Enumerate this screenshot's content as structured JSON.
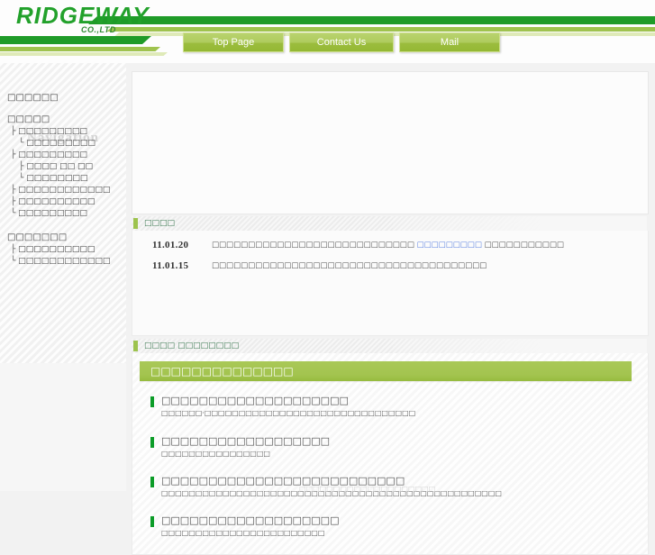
{
  "header": {
    "logo": "RIDGEWAY",
    "logo_sub": "CO.,LTD",
    "nav_buttons": [
      {
        "label": "Top Page",
        "name": "top-page"
      },
      {
        "label": "Contact Us",
        "name": "contact-us"
      },
      {
        "label": "Mail",
        "name": "mail"
      }
    ],
    "brand_green": "#1f9b28",
    "accent_green": "#9fc34e"
  },
  "sidebar": {
    "title": "Navigation",
    "groups": [
      {
        "head": "□□□□□□",
        "items": []
      },
      {
        "head": "□□□□□",
        "items": [
          {
            "prefix": "├",
            "indent": 0,
            "label": "□□□□□□□□□"
          },
          {
            "prefix": "└",
            "indent": 1,
            "label": "□□□□□□□□□"
          },
          {
            "prefix": "├",
            "indent": 0,
            "label": "□□□□□□□□□"
          },
          {
            "prefix": "├",
            "indent": 1,
            "label": "□□□□ □□ □□"
          },
          {
            "prefix": "└",
            "indent": 1,
            "label": "□□□□□□□□"
          },
          {
            "prefix": "├",
            "indent": 0,
            "label": "□□□□□□□□□□□□"
          },
          {
            "prefix": "├",
            "indent": 0,
            "label": "□□□□□□□□□□"
          },
          {
            "prefix": "└",
            "indent": 0,
            "label": "□□□□□□□□□"
          }
        ]
      },
      {
        "head": "□□□□□□□",
        "items": [
          {
            "prefix": "├",
            "indent": 0,
            "label": "□□□□□□□□□□"
          },
          {
            "prefix": "└",
            "indent": 0,
            "label": "□□□□□□□□□□□□"
          }
        ]
      }
    ]
  },
  "main": {
    "hero_alt": "",
    "news_section": {
      "heading": "□□□□",
      "rows": [
        {
          "date": "11.01.20",
          "pre": "□□□□□□□□□□□□□□□□□□□□□□□□□□□□",
          "link": "□□□□□□□□□",
          "post": "□□□□□□□□□□□"
        },
        {
          "date": "11.01.15",
          "pre": "□□□□□□□□□□□□□□□□□□□□□□□□□□□□□□□□□□□□□□",
          "link": "",
          "post": ""
        }
      ],
      "scroll_up": "▲",
      "scroll_down": "▼"
    },
    "products_section": {
      "heading": "□□□□ □□□□□□□□",
      "banner": "□□□□□□□□□□□□□□",
      "items": [
        {
          "title": "□□□□□□□□□□□□□□□□□□□□",
          "desc": "□□□□□□·□□□□□□□□□□□□□□□□□□□□□□□□□□□□□□□"
        },
        {
          "title": "□□□□□□□□□□□□□□□□□□",
          "desc": "□□□□□□□□□□□□□□□□"
        },
        {
          "title": "□□□□□□□□□□□□□□□□□□□□□□□□□□",
          "desc": "□□□□□□□□□□□□□□□□□□□□□□□□□□□□□□□□□□□□□□□□□□□□□□□□□□"
        },
        {
          "title": "□□□□□□□□□□□□□□□□□□□",
          "desc": "□□□□□□□□□□□□□□□□□□□□□□□□"
        }
      ],
      "footer_cut": "□□□□□□□□□□□□□□□□□□□□"
    }
  }
}
